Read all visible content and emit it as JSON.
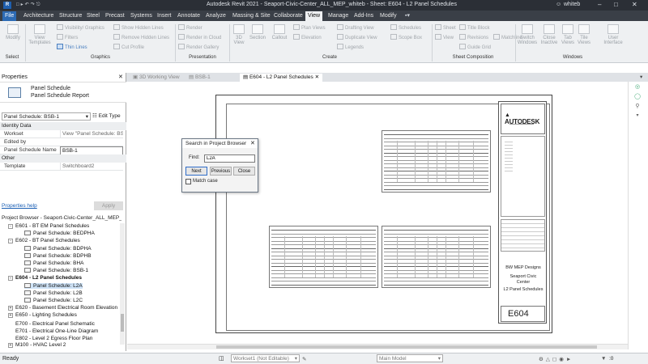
{
  "window": {
    "title": "Autodesk Revit 2021 - Seaport-Civic-Center_ALL_MEP_whiteb - Sheet: E604 - L2 Panel Schedules",
    "user": "whiteb"
  },
  "ribbon_tabs": [
    "File",
    "Architecture",
    "Structure",
    "Steel",
    "Precast",
    "Systems",
    "Insert",
    "Annotate",
    "Analyze",
    "Massing & Site",
    "Collaborate",
    "View",
    "Manage",
    "Add-Ins",
    "Modify"
  ],
  "ribbon": {
    "modify": "Modify",
    "select": "Select",
    "view_templates": "View Templates",
    "visibility": "Visibility/ Graphics",
    "filters": "Filters",
    "thin_lines": "Thin Lines",
    "show_hidden": "Show Hidden Lines",
    "remove_hidden": "Remove Hidden Lines",
    "cut_profile": "Cut Profile",
    "graphics": "Graphics",
    "render": "Render",
    "render_cloud": "Render in Cloud",
    "render_gallery": "Render Gallery",
    "presentation": "Presentation",
    "view_3d": "3D View",
    "section": "Section",
    "callout": "Callout",
    "plan_views": "Plan Views",
    "elevation": "Elevation",
    "drafting_view": "Drafting View",
    "duplicate_view": "Duplicate View",
    "legends": "Legends",
    "schedules": "Schedules",
    "scope_box": "Scope Box",
    "create": "Create",
    "sheet": "Sheet",
    "title_block": "Title Block",
    "view": "View",
    "revisions": "Revisions",
    "guide_grid": "Guide Grid",
    "matchline": "Matchline",
    "sheet_composition": "Sheet Composition",
    "switch_windows": "Switch Windows",
    "close_inactive": "Close Inactive",
    "tab_views": "Tab Views",
    "tile_views": "Tile Views",
    "user_interface": "User Interface",
    "windows": "Windows"
  },
  "properties": {
    "header": "Properties",
    "family_line1": "Panel Schedule",
    "family_line2": "Panel Schedule Report",
    "selector": "Panel Schedule: BSB-1",
    "edit_type": "Edit Type",
    "group_identity": "Identity Data",
    "rows": [
      {
        "k": "Workset",
        "v": "View \"Panel Schedule: BS..."
      },
      {
        "k": "Edited by",
        "v": ""
      },
      {
        "k": "Panel Schedule Name",
        "v": "BSB-1"
      }
    ],
    "group_other": "Other",
    "template_k": "Template",
    "template_v": "Switchboard2",
    "help": "Properties help",
    "apply": "Apply"
  },
  "browser": {
    "header": "Project Browser - Seaport-Civic-Center_ALL_MEP_whiteb...",
    "items": [
      {
        "t": "E601 - BT EM Panel Schedules",
        "lvl": 1,
        "exp": "-",
        "bold": false,
        "sel": false,
        "doc": false
      },
      {
        "t": "Panel Schedule: BEDPHA",
        "lvl": 2,
        "exp": "",
        "bold": false,
        "sel": false,
        "doc": true
      },
      {
        "t": "E602 - BT Panel Schedules",
        "lvl": 1,
        "exp": "-",
        "bold": false,
        "sel": false,
        "doc": false
      },
      {
        "t": "Panel Schedule: BDPHA",
        "lvl": 2,
        "exp": "",
        "bold": false,
        "sel": false,
        "doc": true
      },
      {
        "t": "Panel Schedule: BDPHB",
        "lvl": 2,
        "exp": "",
        "bold": false,
        "sel": false,
        "doc": true
      },
      {
        "t": "Panel Schedule: BHA",
        "lvl": 2,
        "exp": "",
        "bold": false,
        "sel": false,
        "doc": true
      },
      {
        "t": "Panel Schedule: BSB-1",
        "lvl": 2,
        "exp": "",
        "bold": false,
        "sel": false,
        "doc": true
      },
      {
        "t": "E604 - L2 Panel Schedules",
        "lvl": 1,
        "exp": "-",
        "bold": true,
        "sel": false,
        "doc": false
      },
      {
        "t": "Panel Schedule: L2A",
        "lvl": 2,
        "exp": "",
        "bold": false,
        "sel": true,
        "doc": true
      },
      {
        "t": "Panel Schedule: L2B",
        "lvl": 2,
        "exp": "",
        "bold": false,
        "sel": false,
        "doc": true
      },
      {
        "t": "Panel Schedule: L2C",
        "lvl": 2,
        "exp": "",
        "bold": false,
        "sel": false,
        "doc": true
      },
      {
        "t": "E620 - Basement Electrical Room Elevation",
        "lvl": 1,
        "exp": "+",
        "bold": false,
        "sel": false,
        "doc": false
      },
      {
        "t": "E650 - Lighting Schedules",
        "lvl": 1,
        "exp": "+",
        "bold": false,
        "sel": false,
        "doc": false
      },
      {
        "t": "E700 - Electrical Panel Schematic",
        "lvl": 1,
        "exp": "",
        "bold": false,
        "sel": false,
        "doc": false
      },
      {
        "t": "E701 - Electrical One-Line Diagram",
        "lvl": 1,
        "exp": "",
        "bold": false,
        "sel": false,
        "doc": false
      },
      {
        "t": "E802 - Level 2 Egress Floor Plan",
        "lvl": 1,
        "exp": "",
        "bold": false,
        "sel": false,
        "doc": false
      },
      {
        "t": "M100 - HVAC Level 2",
        "lvl": 1,
        "exp": "+",
        "bold": false,
        "sel": false,
        "doc": false
      }
    ]
  },
  "view_tabs": [
    "3D Working View",
    "BSB-1",
    "E604 - L2 Panel Schedules"
  ],
  "titleblock": {
    "logo": "AUTODESK",
    "company": "BW MEP Designs",
    "project_line1": "Seaport Civic",
    "project_line2": "Center",
    "sheet_name": "L2 Panel Schedules",
    "sheet_number": "E604"
  },
  "dialog": {
    "title": "Search in Project Browser",
    "find_label": "Find:",
    "find_value": "L2A",
    "next": "Next",
    "previous": "Previous",
    "close": "Close",
    "match_case": "Match case"
  },
  "status": {
    "ready": "Ready",
    "workset": "Workset1 (Not Editable)",
    "model": "Main Model",
    "zero": ":0"
  }
}
